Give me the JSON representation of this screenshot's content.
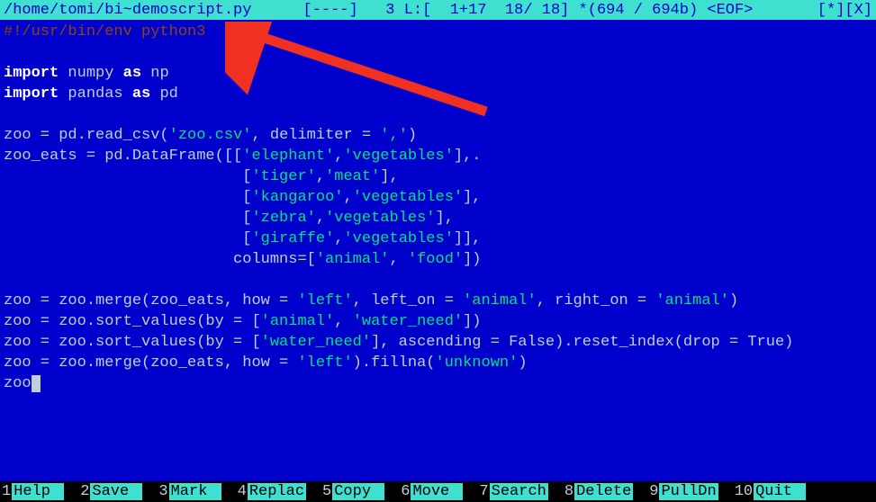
{
  "titlebar": {
    "path": "/home/tomi/bi~demoscript.py",
    "status": "   [----]   3 L:[  1+17  18/ 18] *(694 / 694b) <EOF>       [*][X]"
  },
  "code": {
    "l1": {
      "shebang": "#!/usr/bin/env python3"
    },
    "l2": "",
    "l3": {
      "kw": "import",
      "mod": " numpy ",
      "as": "as",
      "alias": " np"
    },
    "l4": {
      "kw": "import",
      "mod": " pandas ",
      "as": "as",
      "alias": " pd"
    },
    "l5": "",
    "l6": {
      "pre": "zoo = pd.read_csv(",
      "str": "'zoo.csv'",
      "post": ", delimiter = ",
      "str2": "','",
      "end": ")"
    },
    "l7": {
      "pre": "zoo_eats = pd.DataFrame([[",
      "s1": "'elephant'",
      "c1": ",",
      "s2": "'vegetables'",
      "post": "],."
    },
    "l8": {
      "pad": "                          [",
      "s1": "'tiger'",
      "c1": ",",
      "s2": "'meat'",
      "post": "],"
    },
    "l9": {
      "pad": "                          [",
      "s1": "'kangaroo'",
      "c1": ",",
      "s2": "'vegetables'",
      "post": "],"
    },
    "l10": {
      "pad": "                          [",
      "s1": "'zebra'",
      "c1": ",",
      "s2": "'vegetables'",
      "post": "],"
    },
    "l11": {
      "pad": "                          [",
      "s1": "'giraffe'",
      "c1": ",",
      "s2": "'vegetables'",
      "post": "]],"
    },
    "l12": {
      "pad": "                         columns=[",
      "s1": "'animal'",
      "c1": ", ",
      "s2": "'food'",
      "post": "])"
    },
    "l13": "",
    "l14": {
      "pre": "zoo = zoo.merge(zoo_eats, how = ",
      "s1": "'left'",
      "m1": ", left_on = ",
      "s2": "'animal'",
      "m2": ", right_on = ",
      "s3": "'animal'",
      "post": ")"
    },
    "l15": {
      "pre": "zoo = zoo.sort_values(by = [",
      "s1": "'animal'",
      "c1": ", ",
      "s2": "'water_need'",
      "post": "])"
    },
    "l16": {
      "pre": "zoo = zoo.sort_values(by = [",
      "s1": "'water_need'",
      "m1": "], ascending = False).reset_index(drop = True)"
    },
    "l17": {
      "pre": "zoo = zoo.merge(zoo_eats, how = ",
      "s1": "'left'",
      "m1": ").fillna(",
      "s2": "'unknown'",
      "post": ")"
    },
    "l18": {
      "pre": "zoo"
    }
  },
  "footer": {
    "f1": {
      "n": "1",
      "l": "Help  "
    },
    "f2": {
      "n": "2",
      "l": "Save  "
    },
    "f3": {
      "n": "3",
      "l": "Mark  "
    },
    "f4": {
      "n": "4",
      "l": "Replac"
    },
    "f5": {
      "n": "5",
      "l": "Copy  "
    },
    "f6": {
      "n": "6",
      "l": "Move  "
    },
    "f7": {
      "n": "7",
      "l": "Search"
    },
    "f8": {
      "n": "8",
      "l": "Delete"
    },
    "f9": {
      "n": "9",
      "l": "PullDn"
    },
    "f10": {
      "n": "10",
      "l": "Quit  "
    }
  }
}
